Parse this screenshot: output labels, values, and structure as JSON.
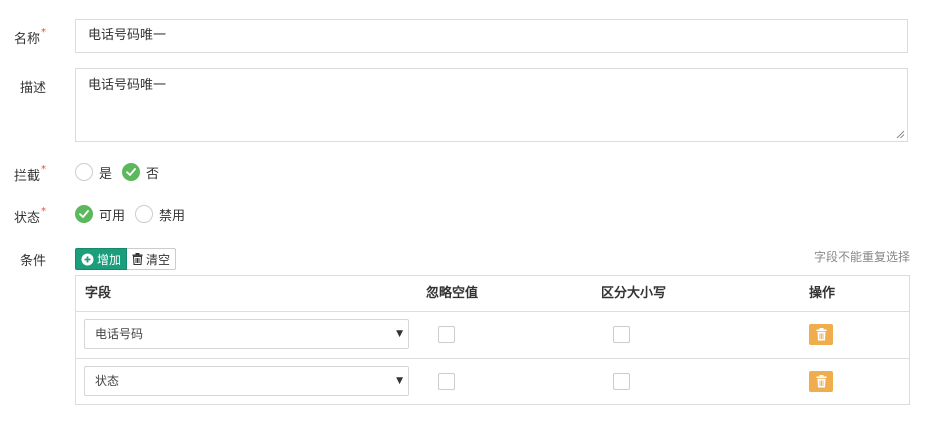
{
  "form": {
    "name": {
      "label": "名称",
      "required": "*",
      "value": "电话号码唯一"
    },
    "desc": {
      "label": "描述",
      "value": "电话号码唯一"
    },
    "intercept": {
      "label": "拦截",
      "required": "*",
      "options": [
        "是",
        "否"
      ],
      "selected": "否"
    },
    "status": {
      "label": "状态",
      "required": "*",
      "options": [
        "可用",
        "禁用"
      ],
      "selected": "可用"
    },
    "conditions": {
      "label": "条件",
      "add_label": "增加",
      "clear_label": "清空",
      "hint": "字段不能重复选择",
      "headers": [
        "字段",
        "忽略空值",
        "区分大小写",
        "操作"
      ],
      "rows": [
        {
          "field": "电话号码",
          "ignore_empty": false,
          "case_sensitive": false
        },
        {
          "field": "状态",
          "ignore_empty": false,
          "case_sensitive": false
        }
      ]
    }
  },
  "colors": {
    "green": "#5cb85c",
    "teal": "#1a9e7c",
    "orange": "#f0ad4e",
    "required": "#e74c3c"
  },
  "icons": {
    "check": "check-icon",
    "plus": "plus-circle-icon",
    "trash": "trash-icon",
    "caret": "caret-down-icon"
  }
}
